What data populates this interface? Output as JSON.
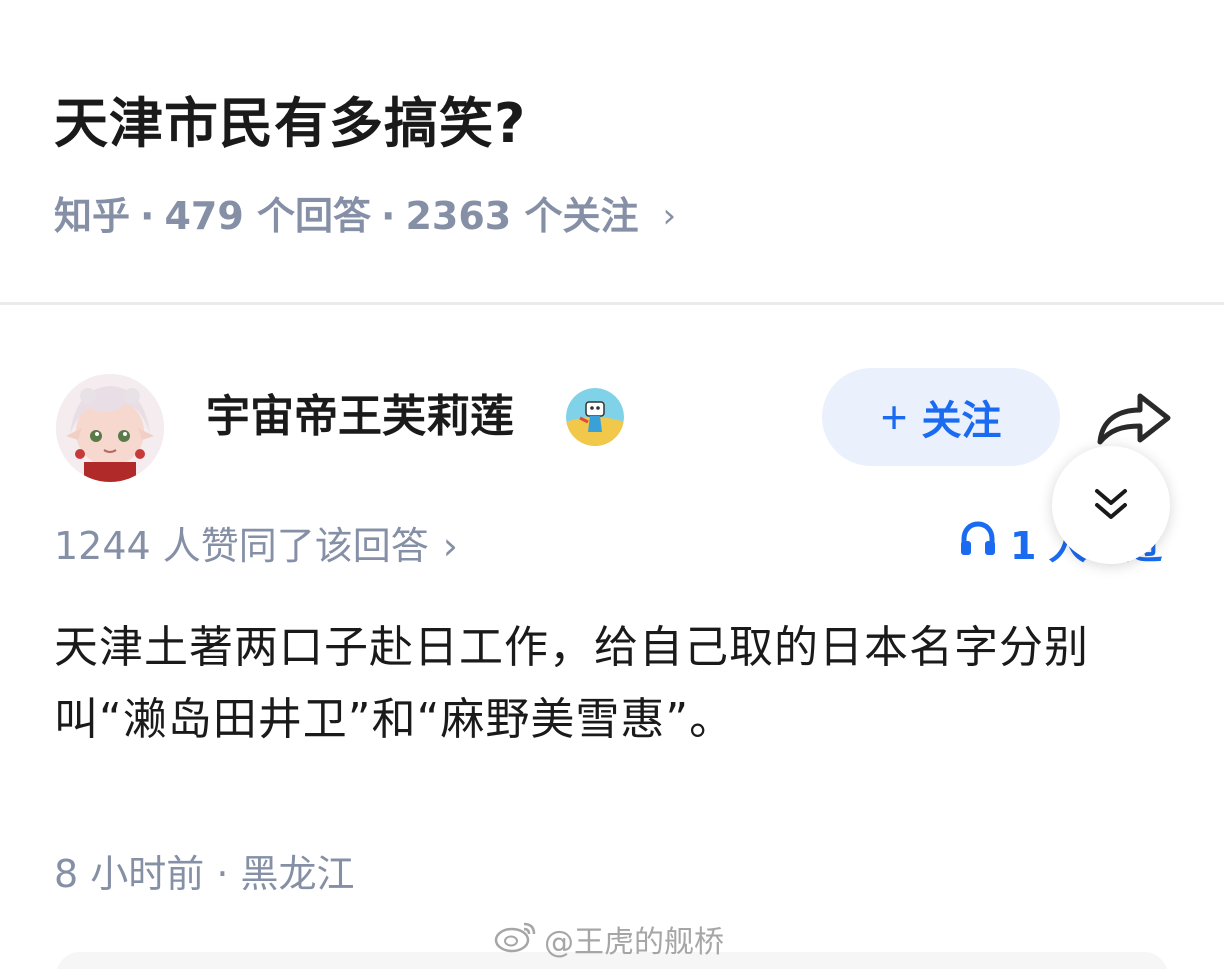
{
  "question": {
    "title": "天津市民有多搞笑?",
    "source": "知乎",
    "sep": "·",
    "answers": "479 个回答",
    "followers": "2363 个关注",
    "chevron": "›"
  },
  "author": {
    "name": "宇宙帝王芙莉莲",
    "follow_icon": "+",
    "follow_label": "关注"
  },
  "answer": {
    "upvotes": "1244 人赞同了该回答",
    "upvote_chevron": "›",
    "listen_count": "1",
    "listen_partial": "人听过",
    "content": "天津土著两口子赴日工作，给自己取的日本名字分别叫“濑岛田井卫”和“麻野美雪惠”。",
    "time": "8 小时前",
    "location": "黑龙江"
  },
  "watermark": {
    "text": "@王虎的舰桥"
  },
  "icons": {
    "share": "share-arrow-icon",
    "collapse": "double-chevron-down-icon",
    "listen": "headphones-icon",
    "badge": "creator-badge-icon",
    "weibo": "weibo-logo-icon"
  },
  "colors": {
    "accent": "#1a6bf0",
    "follow_bg": "#eaf1fd",
    "meta_text": "#8590a6",
    "primary_text": "#1a1a1a"
  }
}
